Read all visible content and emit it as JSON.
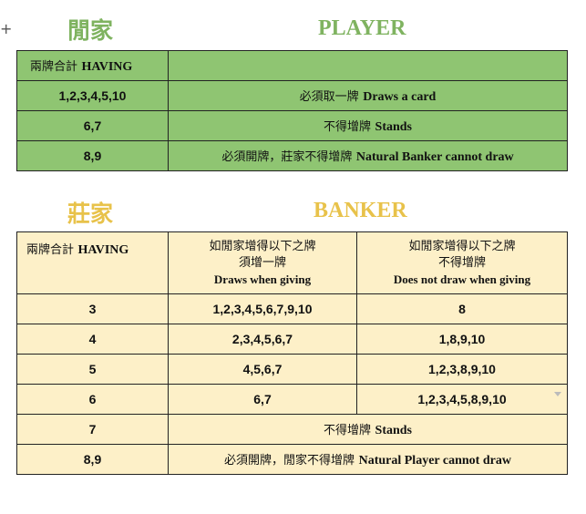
{
  "player_section": {
    "title_cn": "閒家",
    "title_en": "PLAYER",
    "header_label_cn": "兩牌合計",
    "header_label_en": "HAVING",
    "rows": [
      {
        "having": "1,2,3,4,5,10",
        "rule_cn": "必須取一牌",
        "rule_en": "Draws a card"
      },
      {
        "having": "6,7",
        "rule_cn": "不得增牌",
        "rule_en": "Stands"
      },
      {
        "having": "8,9",
        "rule_cn": "必須開牌，莊家不得增牌",
        "rule_en": "Natural Banker cannot draw"
      }
    ]
  },
  "banker_section": {
    "title_cn": "莊家",
    "title_en": "BANKER",
    "header_label_cn": "兩牌合計",
    "header_label_en": "HAVING",
    "col_draw": {
      "line1": "如閒家增得以下之牌",
      "line2": "須增一牌",
      "line3": "Draws when giving"
    },
    "col_nodraw": {
      "line1": "如閒家增得以下之牌",
      "line2": "不得增牌",
      "line3": "Does not draw when giving"
    },
    "rows": [
      {
        "having": "3",
        "draws": "1,2,3,4,5,6,7,9,10",
        "no_draw": "8"
      },
      {
        "having": "4",
        "draws": "2,3,4,5,6,7",
        "no_draw": "1,8,9,10"
      },
      {
        "having": "5",
        "draws": "4,5,6,7",
        "no_draw": "1,2,3,8,9,10"
      },
      {
        "having": "6",
        "draws": "6,7",
        "no_draw": "1,2,3,4,5,8,9,10"
      }
    ],
    "stand_row": {
      "having": "7",
      "rule_cn": "不得增牌",
      "rule_en": "Stands"
    },
    "natural_row": {
      "having": "8,9",
      "rule_cn": "必須開牌，閒家不得增牌",
      "rule_en": "Natural Player cannot draw"
    }
  },
  "colors": {
    "player_fill": "#8fc572",
    "player_title": "#7fb360",
    "banker_fill": "#fdf0c8",
    "banker_title": "#e8c24a"
  }
}
